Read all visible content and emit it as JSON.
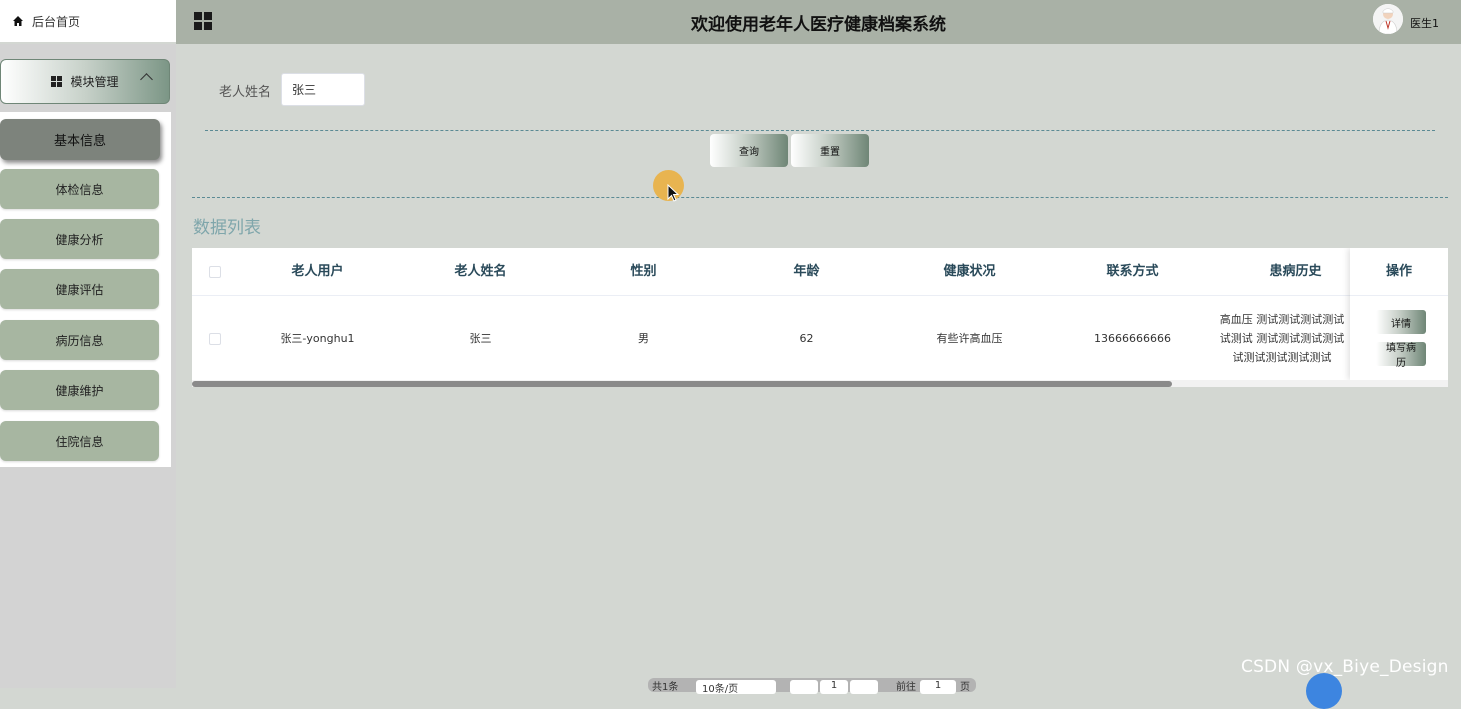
{
  "sidebar": {
    "home_label": "后台首页",
    "module_label": "模块管理",
    "items": [
      {
        "label": "基本信息"
      },
      {
        "label": "体检信息"
      },
      {
        "label": "健康分析"
      },
      {
        "label": "健康评估"
      },
      {
        "label": "病历信息"
      },
      {
        "label": "健康维护"
      },
      {
        "label": "住院信息"
      }
    ]
  },
  "header": {
    "title": "欢迎使用老年人医疗健康档案系统",
    "user": "医生1"
  },
  "search": {
    "label": "老人姓名",
    "value": "张三",
    "query_button": "查询",
    "reset_button": "重置"
  },
  "list": {
    "title": "数据列表",
    "columns": [
      "老人用户",
      "老人姓名",
      "性别",
      "年龄",
      "健康状况",
      "联系方式",
      "患病历史",
      "操作"
    ],
    "rows": [
      {
        "user": "张三-yonghu1",
        "name": "张三",
        "gender": "男",
        "age": "62",
        "health": "有些许高血压",
        "phone": "13666666666",
        "history_lines": [
          "高血压 测试测试测试测试",
          "试测试 测试测试测试测试",
          "试测试测试测试测试"
        ],
        "actions": [
          "详情",
          "填写病历"
        ]
      }
    ]
  },
  "pagination": {
    "total": "共1条",
    "page_size": "10条/页",
    "current_page": "1",
    "goto_label": "前往",
    "goto_value": "1",
    "page_suffix": "页"
  },
  "watermark": "CSDN @vx_Biye_Design",
  "colors": {
    "sidebar_item": "#a7b6a1",
    "sidebar_active": "#7d837c",
    "header": "#a9b1a6",
    "content_bg": "#d3d7d2",
    "list_title": "#7fa6ab"
  }
}
